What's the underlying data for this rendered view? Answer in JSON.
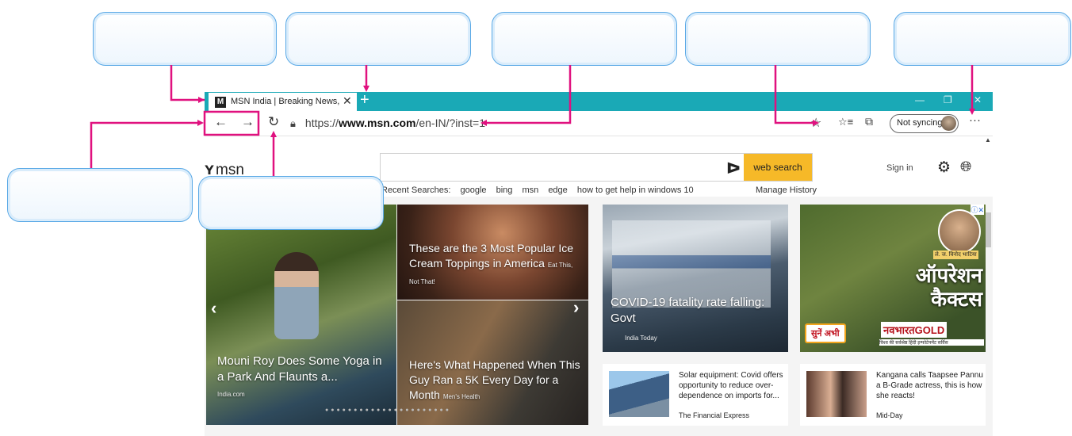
{
  "tab": {
    "title": "MSN India | Breaking News, Ente",
    "close": "✕",
    "new_tab": "+",
    "favicon": "M"
  },
  "window": {
    "minimize": "—",
    "restore": "❐",
    "close": "✕"
  },
  "toolbar": {
    "back": "←",
    "forward": "→",
    "refresh": "↻",
    "lock": "🔒",
    "url_prefix": "https://",
    "url_domain": "www.msn.com",
    "url_path": "/en-IN/?inst=1",
    "favorite": "☆",
    "favorites": "☆≡",
    "collections": "⧉",
    "sync_label": "Not syncing",
    "more": "···"
  },
  "msn": {
    "logo": "msn",
    "logo_mark": "ʏ",
    "search_button": "web search",
    "bing_mark": "ᐅ",
    "recent_label": "Recent Searches:",
    "recent": [
      "google",
      "bing",
      "msn",
      "edge",
      "how to get help in windows 10"
    ],
    "manage_history": "Manage History",
    "sign_in": "Sign in",
    "gear": "⚙",
    "globe": "🌐"
  },
  "carousel": {
    "main_caption": "Mouni Roy Does Some Yoga in a Park And Flaunts a...",
    "main_source": "India.com",
    "top_caption": "These are the 3 Most Popular Ice Cream Toppings in America",
    "top_source": "Eat This, Not That!",
    "bottom_caption": "Here's What Happened When This Guy Ran a 5K Every Day for a Month",
    "bottom_source": "Men's Health",
    "prev": "‹",
    "next": "›",
    "dots": "●●●●●●●●●●●●●●●●●●●●●●"
  },
  "covid": {
    "caption": "COVID-19 fatality rate falling: Govt",
    "source": "India Today"
  },
  "ad": {
    "headline": "ऑपरेशन कैक्टस",
    "listen": "सुनें अभी",
    "brand": "नवभारतGOLD",
    "tagline": "विश्व की सर्वश्रेष्ठ हिंदी इन्फोटेनमेंट सर्विस",
    "badge": "ⓘ✕",
    "name_tag": "ले. ज. विनोद भाटिया"
  },
  "news1": {
    "text": "Solar equipment: Covid offers opportunity to reduce over-dependence on imports for...",
    "publisher": "The Financial Express"
  },
  "news2": {
    "text": "Kangana calls Taapsee Pannu a B-Grade actress, this is how she reacts!",
    "publisher": "Mid-Day"
  },
  "colors": {
    "tabbar": "#1aa9b6",
    "callout_border": "#5aa9e6",
    "annotation": "#e0117f",
    "search_button": "#f6b928"
  }
}
